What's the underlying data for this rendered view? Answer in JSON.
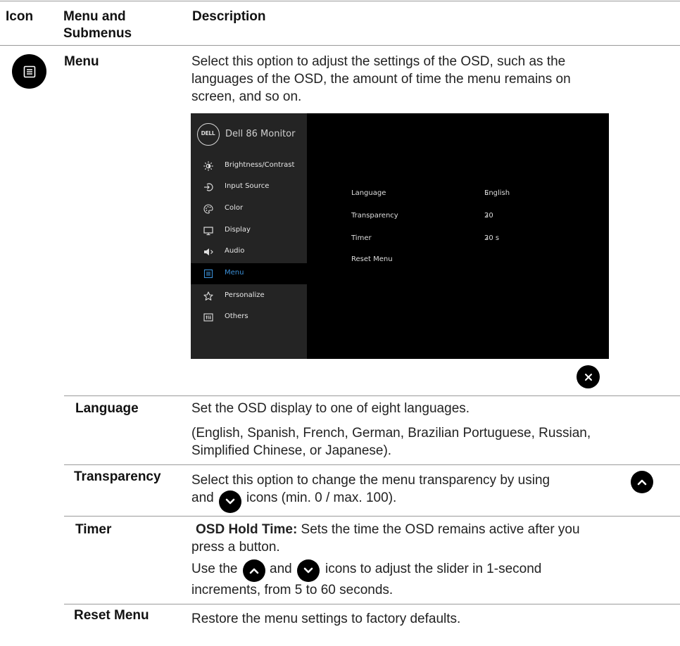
{
  "header": {
    "col_icon": "Icon",
    "col_menu_line1": "Menu and",
    "col_menu_line2": "Submenus",
    "col_desc": "Description"
  },
  "menu": {
    "title": "Menu",
    "desc_line1": "Select this option to adjust the settings of the OSD, such as the",
    "desc_line2": "languages of the OSD, the amount of time the menu remains on",
    "desc_line3": "screen, and so on."
  },
  "osd": {
    "brand": "DELL",
    "model": "Dell 86 Monitor",
    "sidebar": [
      {
        "label": "Brightness/Contrast",
        "icon": "brightness-icon"
      },
      {
        "label": "Input Source",
        "icon": "input-source-icon"
      },
      {
        "label": "Color",
        "icon": "color-palette-icon"
      },
      {
        "label": "Display",
        "icon": "display-icon"
      },
      {
        "label": "Audio",
        "icon": "speaker-icon"
      },
      {
        "label": "Menu",
        "icon": "menu-icon"
      },
      {
        "label": "Personalize",
        "icon": "star-icon"
      },
      {
        "label": "Others",
        "icon": "others-icon"
      }
    ],
    "active_item": "Menu",
    "rows": [
      {
        "label": "Language",
        "value": "English"
      },
      {
        "label": "Transparency",
        "value": "20"
      },
      {
        "label": "Timer",
        "value": "20 s"
      },
      {
        "label": "Reset Menu",
        "value": ""
      }
    ],
    "accent_color": "#3b8fd6"
  },
  "language": {
    "title": "Language",
    "desc_line1": "Set the OSD display to one of eight languages.",
    "desc_line2": "(English, Spanish, French, German, Brazilian Portuguese, Russian,",
    "desc_line3": "Simplified Chinese, or Japanese)."
  },
  "transparency": {
    "title": "Transparency",
    "desc_part1": "Select this option to change the menu transparency by using",
    "desc_part2": "and",
    "desc_part3": "icons (min. 0 / max. 100)."
  },
  "timer": {
    "title": "Timer",
    "bold_label": "OSD Hold Time:",
    "desc_line1_rest": " Sets the time the OSD remains active after you",
    "desc_line2": "press a button.",
    "desc_line3_a": "Use the",
    "desc_line3_b": "and",
    "desc_line3_c": "icons to adjust the slider in 1-second",
    "desc_line4": "increments, from 5 to 60 seconds."
  },
  "reset_menu": {
    "title": "Reset Menu",
    "desc": "Restore the menu settings to factory defaults."
  }
}
